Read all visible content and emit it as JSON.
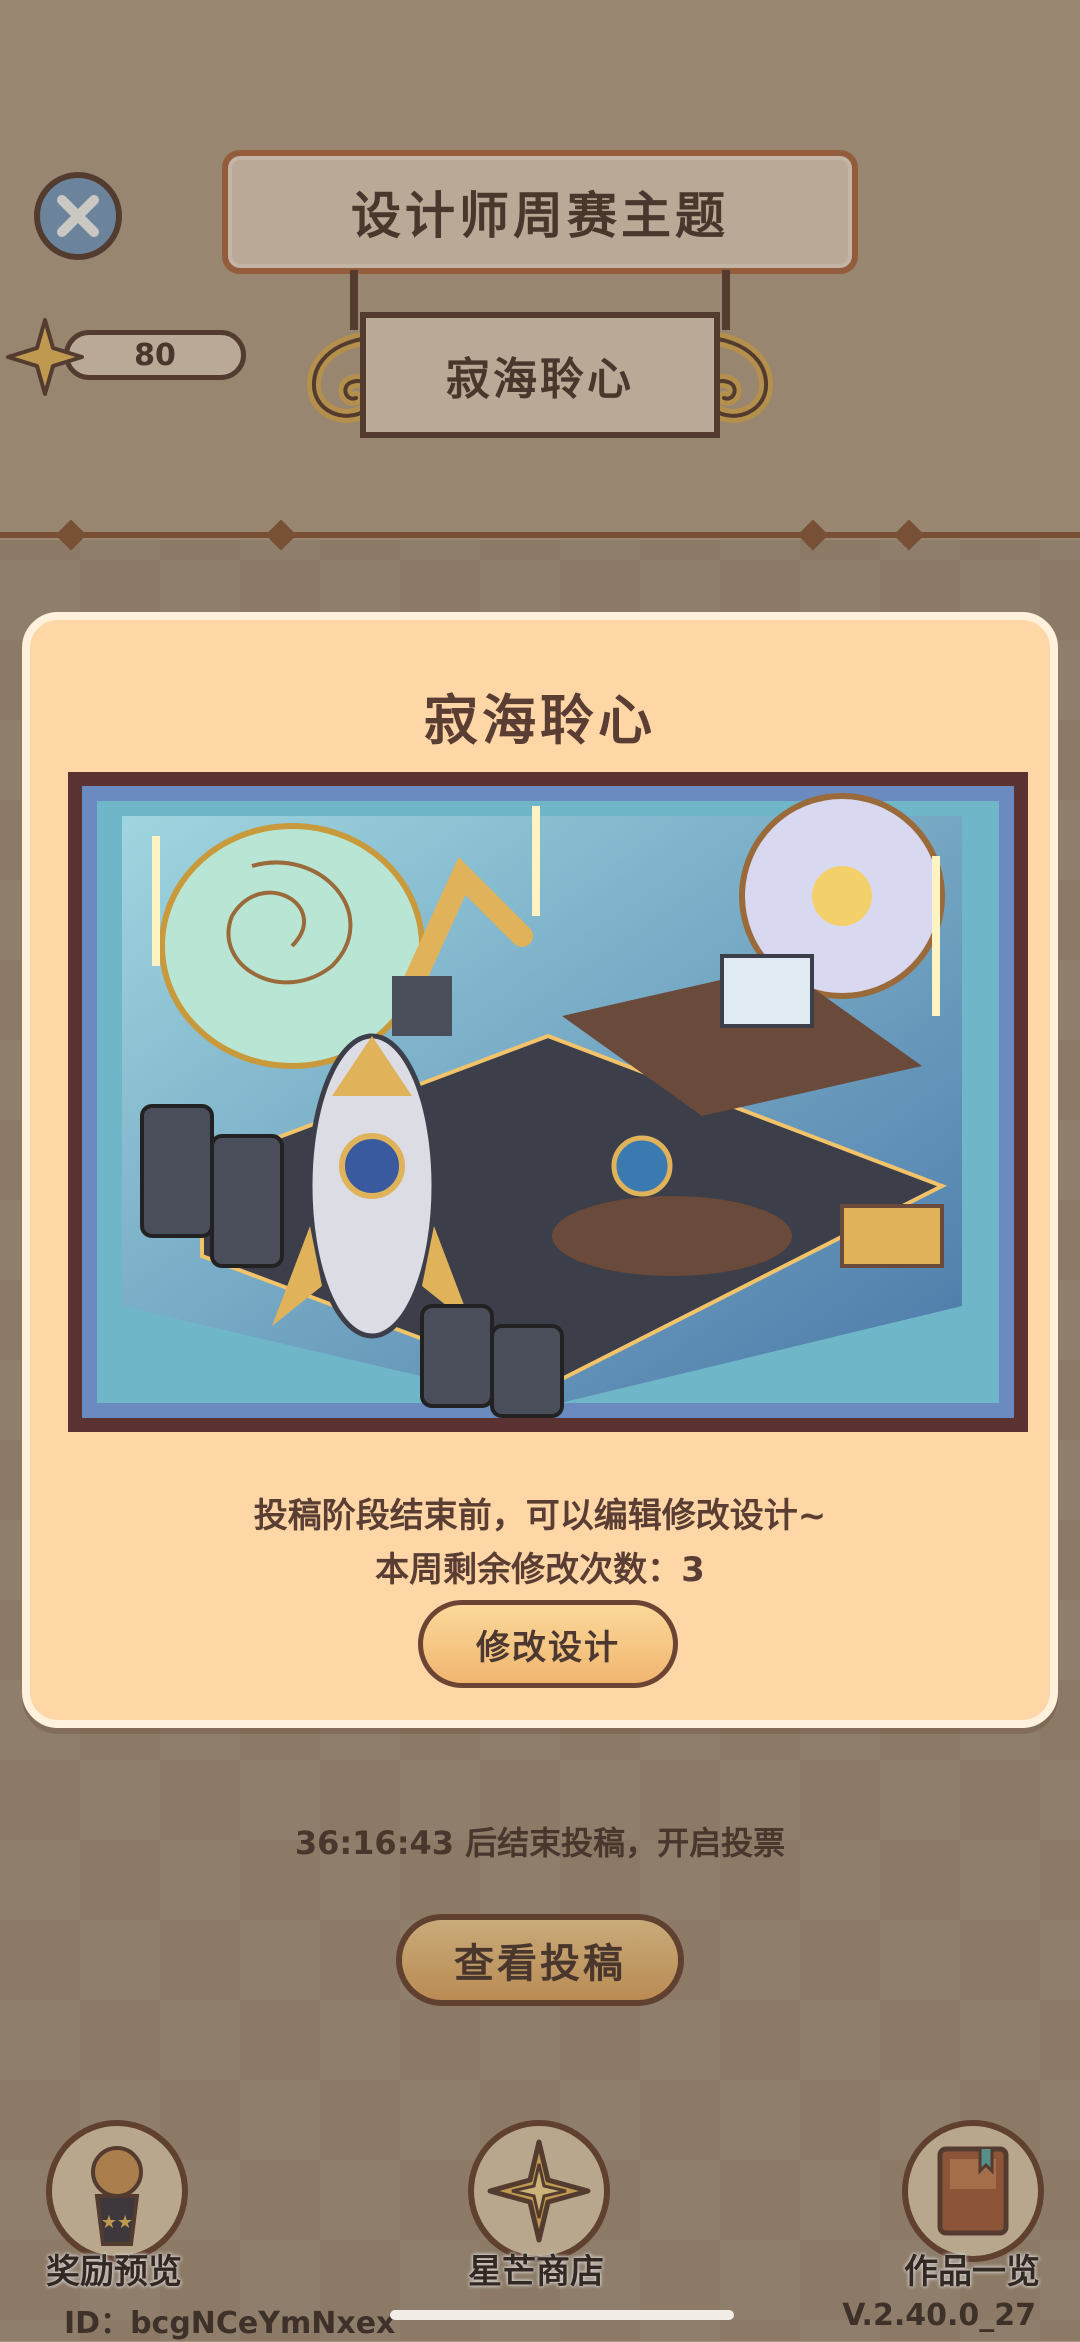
{
  "header": {
    "title": "设计师周赛主题",
    "theme": "寂海聆心",
    "star_count": "80"
  },
  "modal": {
    "title": "寂海聆心",
    "description_line1": "投稿阶段结束前，可以编辑修改设计~",
    "description_line2": "本周剩余修改次数：3",
    "edit_button": "修改设计"
  },
  "main": {
    "countdown": "36:16:43 后结束投稿，开启投票",
    "view_button": "查看投稿"
  },
  "nav": {
    "items": [
      {
        "label": "奖励预览",
        "icon": "trophy-icon"
      },
      {
        "label": "星芒商店",
        "icon": "star-icon"
      },
      {
        "label": "作品一览",
        "icon": "book-icon"
      }
    ]
  },
  "footer": {
    "id": "ID：bcgNCeYmNxex",
    "version": "V.2.40.0_27"
  },
  "colors": {
    "panel": "#ffd7a7",
    "border_dark": "#5a3e33",
    "button_fill": "#f0b670",
    "close_button": "#7aa1c8"
  }
}
